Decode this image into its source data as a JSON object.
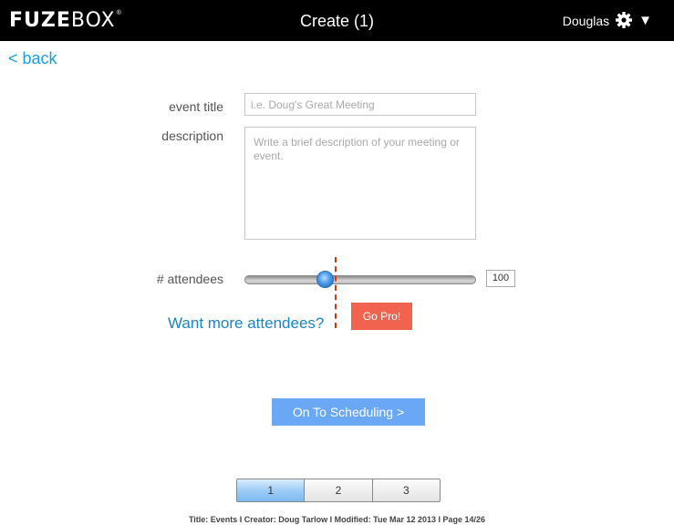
{
  "header": {
    "logo_bold": "FUZE",
    "logo_light": "BOX",
    "logo_tm": "®",
    "title": "Create (1)",
    "user_name": "Douglas",
    "caret": "▼"
  },
  "nav": {
    "back_label": "< back"
  },
  "form": {
    "event_title_label": "event title",
    "event_title_placeholder": "i.e. Doug's Great Meeting",
    "description_label": "description",
    "description_placeholder": "Write a brief description of your meeting or event.",
    "attendees_label": "# attendees",
    "attendees_value": "100",
    "slider_fraction": 0.35
  },
  "upsell": {
    "want_more_text": "Want more attendees?",
    "go_pro_label": "Go Pro!"
  },
  "actions": {
    "scheduling_label": "On To Scheduling >"
  },
  "pager": {
    "pages": [
      "1",
      "2",
      "3"
    ],
    "active": "1"
  },
  "footer": {
    "text": "Title: Events  I  Creator: Doug Tarlow  I  Modified: Tue Mar 12 2013  I  Page 14/26"
  },
  "colors": {
    "accent": "#1a9fe0",
    "go_pro": "#f2634f",
    "primary_button": "#6aa8f5"
  },
  "icons": {
    "settings": "gear-icon",
    "menu": "chevron-down-icon"
  }
}
